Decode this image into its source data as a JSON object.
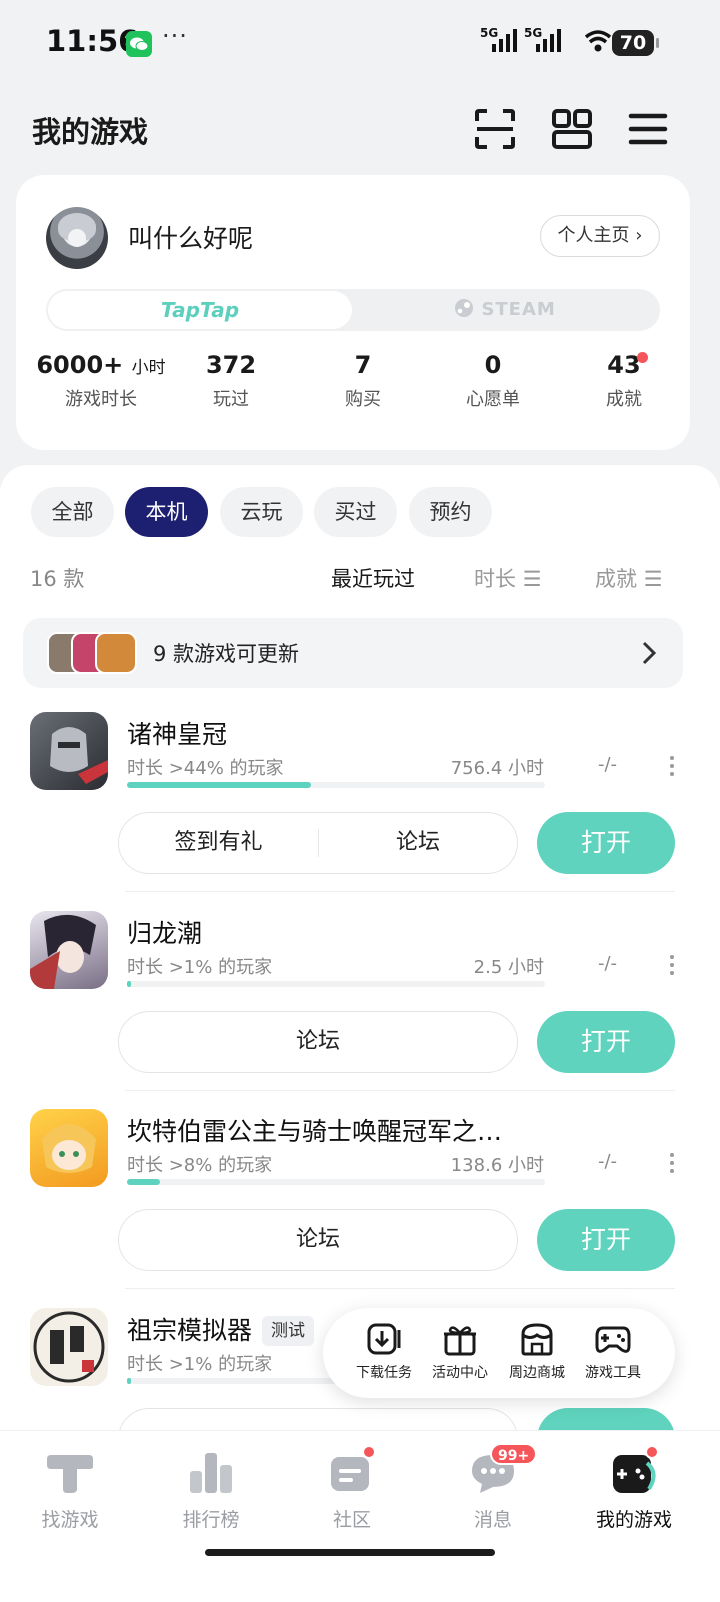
{
  "status_bar": {
    "time": "11:56",
    "more": "···",
    "network_1": "5G",
    "network_2": "5G",
    "battery": "70"
  },
  "header": {
    "title": "我的游戏"
  },
  "profile": {
    "username": "叫什么好呢",
    "homepage_label": "个人主页",
    "platform_active": "TapTap",
    "platform_inactive": "STEAM",
    "stats": [
      {
        "value": "6000+",
        "unit": "小时",
        "label": "游戏时长"
      },
      {
        "value": "372",
        "label": "玩过"
      },
      {
        "value": "7",
        "label": "购买"
      },
      {
        "value": "0",
        "label": "心愿单"
      },
      {
        "value": "43",
        "label": "成就"
      }
    ]
  },
  "filters": [
    "全部",
    "本机",
    "云玩",
    "买过",
    "预约"
  ],
  "filter_active": "本机",
  "list": {
    "count": "16 款",
    "sort_recent": "最近玩过",
    "sort_duration": "时长",
    "sort_achievement": "成就"
  },
  "update_banner": {
    "text": "9 款游戏可更新"
  },
  "games": [
    {
      "name": "诸神皇冠",
      "meta": "时长 >44% 的玩家",
      "hours": "756.4 小时",
      "achievement": "-/-",
      "progress": 0.44,
      "action_1": "签到有礼",
      "action_2": "论坛",
      "open": "打开"
    },
    {
      "name": "归龙潮",
      "meta": "时长 >1% 的玩家",
      "hours": "2.5 小时",
      "achievement": "-/-",
      "progress": 0.01,
      "action_1": "论坛",
      "open": "打开"
    },
    {
      "name": "坎特伯雷公主与骑士唤醒冠军之…",
      "meta": "时长 >8% 的玩家",
      "hours": "138.6 小时",
      "achievement": "-/-",
      "progress": 0.08,
      "action_1": "论坛",
      "open": "打开"
    },
    {
      "name": "祖宗模拟器",
      "badge": "测试",
      "meta": "时长 >1% 的玩家",
      "progress": 0.01
    }
  ],
  "quick_actions": [
    "下载任务",
    "活动中心",
    "周边商城",
    "游戏工具"
  ],
  "tabs": [
    "找游戏",
    "排行榜",
    "社区",
    "消息",
    "我的游戏"
  ],
  "tab_active": "我的游戏",
  "messages_badge": "99+",
  "colors": {
    "accent": "#5fd3bd",
    "active_filter": "#1d1f70",
    "badge": "#f5565a"
  }
}
